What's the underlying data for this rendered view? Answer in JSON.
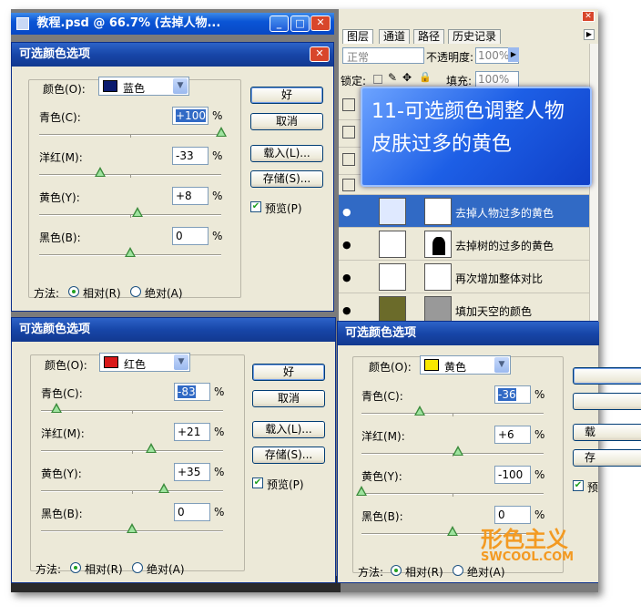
{
  "doc_window": {
    "title": "教程.psd @ 66.7% (去掉人物..."
  },
  "dialog_title": "可选颜色选项",
  "dialogs": [
    {
      "color_label": "颜色(O):",
      "color_value": "蓝色",
      "swatch": "#0a1a6e",
      "sliders": [
        {
          "label": "青色(C):",
          "value": "+100",
          "pos": 1.0
        },
        {
          "label": "洋红(M):",
          "value": "-33",
          "pos": 0.335
        },
        {
          "label": "黄色(Y):",
          "value": "+8",
          "pos": 0.54
        },
        {
          "label": "黑色(B):",
          "value": "0",
          "pos": 0.5
        }
      ],
      "method_label": "方法:",
      "relative": "相对(R)",
      "absolute": "绝对(A)",
      "buttons": [
        "好",
        "取消",
        "载入(L)...",
        "存储(S)..."
      ],
      "preview": "预览(P)"
    },
    {
      "color_label": "颜色(O):",
      "color_value": "红色",
      "swatch": "#d81818",
      "sliders": [
        {
          "label": "青色(C):",
          "value": "-83",
          "pos": 0.085
        },
        {
          "label": "洋红(M):",
          "value": "+21",
          "pos": 0.605
        },
        {
          "label": "黄色(Y):",
          "value": "+35",
          "pos": 0.675
        },
        {
          "label": "黑色(B):",
          "value": "0",
          "pos": 0.5
        }
      ],
      "method_label": "方法:",
      "relative": "相对(R)",
      "absolute": "绝对(A)",
      "buttons": [
        "好",
        "取消",
        "载入(L)...",
        "存储(S)..."
      ],
      "preview": "预览(P)"
    },
    {
      "color_label": "颜色(O):",
      "color_value": "黄色",
      "swatch": "#f8e800",
      "sliders": [
        {
          "label": "青色(C):",
          "value": "-36",
          "pos": 0.32
        },
        {
          "label": "洋红(M):",
          "value": "+6",
          "pos": 0.53
        },
        {
          "label": "黄色(Y):",
          "value": "-100",
          "pos": 0.0
        },
        {
          "label": "黑色(B):",
          "value": "0",
          "pos": 0.5
        }
      ],
      "method_label": "方法:",
      "relative": "相对(R)",
      "absolute": "绝对(A)",
      "buttons": [
        "载",
        "存"
      ],
      "preview": "预"
    }
  ],
  "layers_panel": {
    "tabs": [
      "图层",
      "通道",
      "路径",
      "历史记录"
    ],
    "blend_mode": "正常",
    "opacity_label": "不透明度:",
    "opacity": "100%",
    "lock_label": "锁定:",
    "fill_label": "填充:",
    "fill": "100%",
    "layers": [
      {
        "name": "去掉人物过多的黄色",
        "active": true
      },
      {
        "name": "去掉树的过多的黄色",
        "active": false
      },
      {
        "name": "再次增加整体对比",
        "active": false
      },
      {
        "name": "填加天空的颜色",
        "active": false
      }
    ]
  },
  "banner_text": "11-可选颜色调整人物皮肤过多的黄色",
  "watermark": {
    "brand": "形色主义",
    "site": "SWCOOL.COM"
  },
  "colors": {
    "titlebar": "#1746a8",
    "dialog_bg": "#ece9d8",
    "selection": "#316ac5",
    "watermark": "#f39a22"
  }
}
